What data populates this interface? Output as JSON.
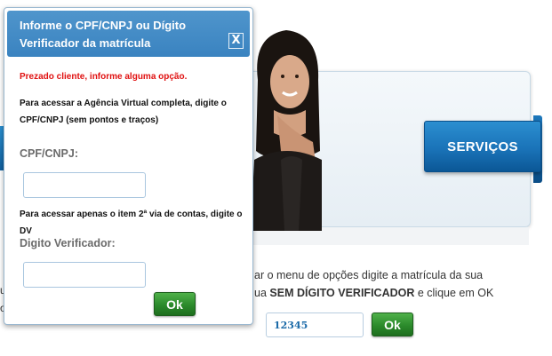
{
  "modal": {
    "title": "Informe o CPF/CNPJ ou Dígito Verificador da matrícula",
    "close_label": "X",
    "alert": "Prezado cliente, informe alguma opção.",
    "instruction_full": "Para acessar a Agência Virtual completa, digite o CPF/CNPJ (sem pontos e traços)",
    "cpf_label": "CPF/CNPJ:",
    "cpf_value": "",
    "instruction_partial": "Para acessar apenas o item 2ª via de contas, digite o DV",
    "dv_label": "Digito Verificador:",
    "dv_value": "",
    "ok_label": "Ok"
  },
  "background": {
    "servicos_label": "SERVIÇOS",
    "instruction_line1": "ar o menu de opções digite a matrícula da sua",
    "instruction_line2_prefix": "ua ",
    "instruction_line2_bold": "SEM DÍGITO VERIFICADOR",
    "instruction_line2_suffix": " e clique em OK",
    "left_peek1": "u",
    "left_peek2": "o",
    "matricula_value": "12345",
    "ok_label": "Ok"
  },
  "colors": {
    "modal_header": "#4589c6",
    "alert_red": "#e01010",
    "ok_green": "#2b8a2b",
    "servicos_blue": "#1a73b8"
  }
}
